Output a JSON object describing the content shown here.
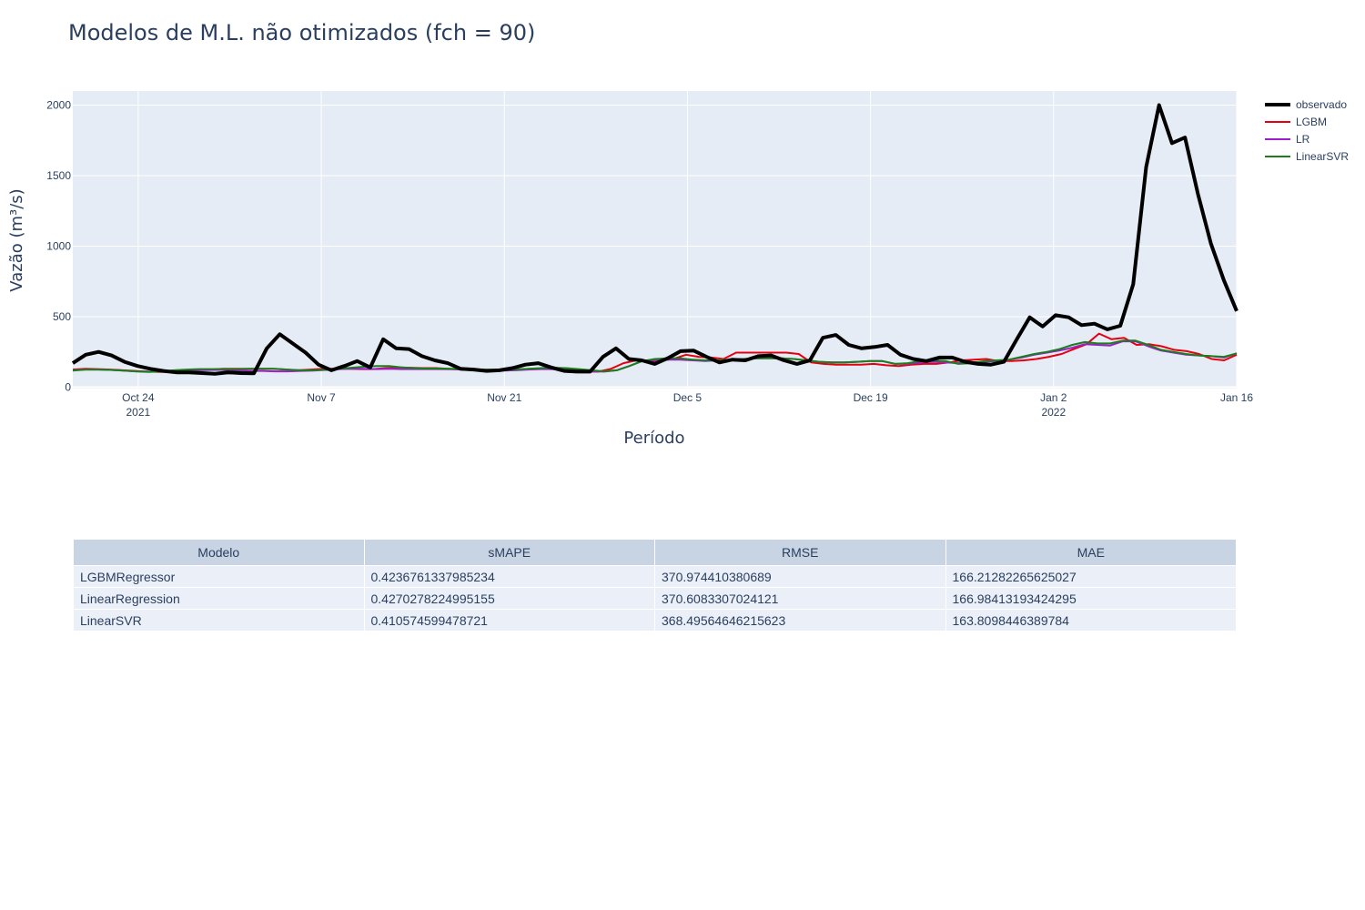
{
  "title": "Modelos de M.L. não otimizados (fch = 90)",
  "chart_data": {
    "type": "line",
    "xlabel": "Período",
    "ylabel": "Vazão (m³/s)",
    "x_start": "2021-10-19",
    "x_range": [
      "2021-10-19",
      "2022-01-16"
    ],
    "ylim": [
      -10,
      2100
    ],
    "y_ticks": [
      0,
      500,
      1000,
      1500,
      2000
    ],
    "x_ticks": [
      {
        "date": "2021-10-24",
        "label": "Oct 24",
        "sublabel": "2021"
      },
      {
        "date": "2021-11-07",
        "label": "Nov 7",
        "sublabel": ""
      },
      {
        "date": "2021-11-21",
        "label": "Nov 21",
        "sublabel": ""
      },
      {
        "date": "2021-12-05",
        "label": "Dec 5",
        "sublabel": ""
      },
      {
        "date": "2021-12-19",
        "label": "Dec 19",
        "sublabel": ""
      },
      {
        "date": "2022-01-02",
        "label": "Jan 2",
        "sublabel": "2022"
      },
      {
        "date": "2022-01-16",
        "label": "Jan 16",
        "sublabel": ""
      }
    ],
    "grid": true,
    "legend_position": "right",
    "series": [
      {
        "name": "observado",
        "color": "#000000",
        "width": 4,
        "values": [
          170,
          230,
          250,
          225,
          180,
          150,
          130,
          115,
          105,
          105,
          100,
          95,
          105,
          100,
          98,
          275,
          375,
          310,
          245,
          160,
          120,
          150,
          185,
          140,
          340,
          275,
          270,
          220,
          190,
          170,
          130,
          125,
          115,
          120,
          135,
          160,
          170,
          140,
          115,
          110,
          110,
          215,
          275,
          200,
          190,
          165,
          205,
          255,
          260,
          215,
          175,
          195,
          190,
          220,
          225,
          190,
          165,
          190,
          350,
          370,
          300,
          275,
          285,
          300,
          230,
          200,
          185,
          210,
          210,
          180,
          165,
          160,
          180,
          340,
          495,
          430,
          510,
          495,
          440,
          450,
          410,
          435,
          730,
          1560,
          2000,
          1730,
          1770,
          1370,
          1020,
          760,
          540
        ]
      },
      {
        "name": "LGBM",
        "color": "#e6000f",
        "width": 2,
        "values": [
          125,
          130,
          128,
          125,
          120,
          115,
          110,
          108,
          110,
          120,
          125,
          125,
          130,
          130,
          130,
          130,
          130,
          125,
          120,
          125,
          130,
          130,
          130,
          128,
          128,
          135,
          140,
          138,
          135,
          135,
          130,
          125,
          120,
          118,
          118,
          122,
          128,
          130,
          130,
          125,
          120,
          110,
          110,
          130,
          170,
          190,
          180,
          190,
          200,
          230,
          215,
          210,
          200,
          245,
          245,
          245,
          245,
          245,
          235,
          175,
          165,
          160,
          160,
          160,
          165,
          155,
          150,
          160,
          165,
          165,
          175,
          190,
          195,
          200,
          185,
          185,
          190,
          200,
          215,
          235,
          270,
          305,
          380,
          340,
          350,
          300,
          305,
          290,
          265,
          255,
          235,
          200,
          190,
          230
        ]
      },
      {
        "name": "LR",
        "color": "#9b1fcc",
        "width": 2,
        "values": [
          120,
          125,
          125,
          122,
          118,
          112,
          110,
          112,
          115,
          118,
          120,
          122,
          122,
          118,
          115,
          115,
          112,
          112,
          115,
          118,
          122,
          128,
          130,
          130,
          128,
          130,
          128,
          128,
          128,
          128,
          127,
          125,
          122,
          120,
          118,
          120,
          125,
          128,
          128,
          125,
          118,
          112,
          110,
          120,
          150,
          185,
          190,
          195,
          195,
          190,
          185,
          190,
          195,
          200,
          205,
          205,
          205,
          200,
          190,
          180,
          175,
          175,
          180,
          185,
          185,
          165,
          165,
          175,
          180,
          175,
          170,
          175,
          180,
          185,
          195,
          210,
          230,
          245,
          260,
          280,
          305,
          300,
          295,
          325,
          325,
          290,
          260,
          245,
          230,
          225,
          220,
          210,
          240
        ]
      },
      {
        "name": "LinearSVR",
        "color": "#1a7f1a",
        "width": 2,
        "values": [
          118,
          125,
          125,
          122,
          118,
          112,
          108,
          112,
          120,
          125,
          128,
          128,
          128,
          128,
          130,
          130,
          130,
          125,
          120,
          120,
          125,
          130,
          138,
          145,
          150,
          150,
          140,
          135,
          132,
          132,
          130,
          128,
          125,
          125,
          122,
          125,
          130,
          135,
          138,
          135,
          128,
          120,
          112,
          120,
          150,
          185,
          200,
          205,
          205,
          195,
          190,
          190,
          195,
          200,
          205,
          205,
          205,
          200,
          190,
          180,
          175,
          175,
          180,
          185,
          185,
          165,
          170,
          185,
          190,
          185,
          165,
          170,
          185,
          190,
          195,
          215,
          235,
          250,
          270,
          300,
          320,
          310,
          310,
          330,
          330,
          300,
          265,
          250,
          235,
          225,
          220,
          215,
          240
        ]
      }
    ]
  },
  "table": {
    "headers": [
      "Modelo",
      "sMAPE",
      "RMSE",
      "MAE"
    ],
    "rows": [
      [
        "LGBMRegressor",
        "0.4236761337985234",
        "370.974410380689",
        "166.21282265625027"
      ],
      [
        "LinearRegression",
        "0.4270278224995155",
        "370.6083307024121",
        "166.98413193424295"
      ],
      [
        "LinearSVR",
        "0.410574599478721",
        "368.49564646215623",
        "163.8098446389784"
      ]
    ]
  }
}
